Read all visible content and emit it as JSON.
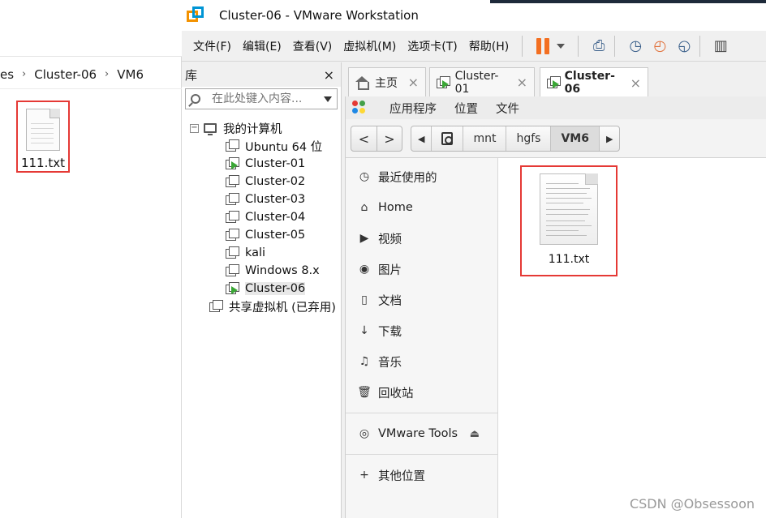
{
  "explorer": {
    "breadcrumb": [
      "es",
      "VM6"
    ],
    "breadcrumb_mid": "Cluster-06",
    "file_name": "111.txt",
    "highlight_color": "#e53935"
  },
  "vmware": {
    "title": "Cluster-06 - VMware Workstation",
    "menu": [
      "文件(F)",
      "编辑(E)",
      "查看(V)",
      "虚拟机(M)",
      "选项卡(T)",
      "帮助(H)"
    ],
    "toolbar_icons": [
      "pause-icon",
      "dropdown-icon",
      "send-keys-icon",
      "snapshot-icon",
      "revert-snapshot-icon",
      "snapshot-manager-icon",
      "fullscreen-icon"
    ],
    "pause_color": "#f36f21",
    "library": {
      "title": "库",
      "close_glyph": "×",
      "search_placeholder": "在此处键入内容...",
      "root": "我的计算机",
      "toggle": "−",
      "vms": [
        {
          "name": "Ubuntu 64 位",
          "running": false
        },
        {
          "name": "Cluster-01",
          "running": true
        },
        {
          "name": "Cluster-02",
          "running": false
        },
        {
          "name": "Cluster-03",
          "running": false
        },
        {
          "name": "Cluster-04",
          "running": false
        },
        {
          "name": "Cluster-05",
          "running": false
        },
        {
          "name": "kali",
          "running": false
        },
        {
          "name": "Windows 8.x",
          "running": false
        },
        {
          "name": "Cluster-06",
          "running": true
        }
      ],
      "shared": "共享虚拟机 (已弃用)"
    },
    "tabs": [
      {
        "label": "主页",
        "icon": "home-icon"
      },
      {
        "label": "Cluster-01",
        "icon": "vm-running-icon"
      },
      {
        "label": "Cluster-06",
        "icon": "vm-running-icon",
        "active": true
      }
    ],
    "tab_close_glyph": "×"
  },
  "guest": {
    "topbar": [
      "应用程序",
      "位置",
      "文件"
    ],
    "nav": {
      "back": "<",
      "forward": ">"
    },
    "path": [
      "mnt",
      "hgfs",
      "VM6"
    ],
    "path_left_arrow": "◀",
    "path_right_arrow": "▶",
    "places": [
      {
        "label": "最近使用的",
        "icon": "recent-icon",
        "glyph": "◷"
      },
      {
        "label": "Home",
        "icon": "home-icon",
        "glyph": "⌂"
      },
      {
        "label": "视频",
        "icon": "video-icon",
        "glyph": "▶"
      },
      {
        "label": "图片",
        "icon": "camera-icon",
        "glyph": "◉"
      },
      {
        "label": "文档",
        "icon": "document-icon",
        "glyph": "▯"
      },
      {
        "label": "下载",
        "icon": "download-icon",
        "glyph": "↓"
      },
      {
        "label": "音乐",
        "icon": "music-icon",
        "glyph": "♫"
      },
      {
        "label": "回收站",
        "icon": "trash-icon",
        "glyph": "🗑"
      }
    ],
    "device": {
      "label": "VMware Tools",
      "icon": "disc-icon",
      "glyph": "◎",
      "eject": "⏏"
    },
    "other": {
      "label": "其他位置",
      "glyph": "+"
    },
    "file_name": "111.txt"
  },
  "watermark": "CSDN @Obsessoon"
}
